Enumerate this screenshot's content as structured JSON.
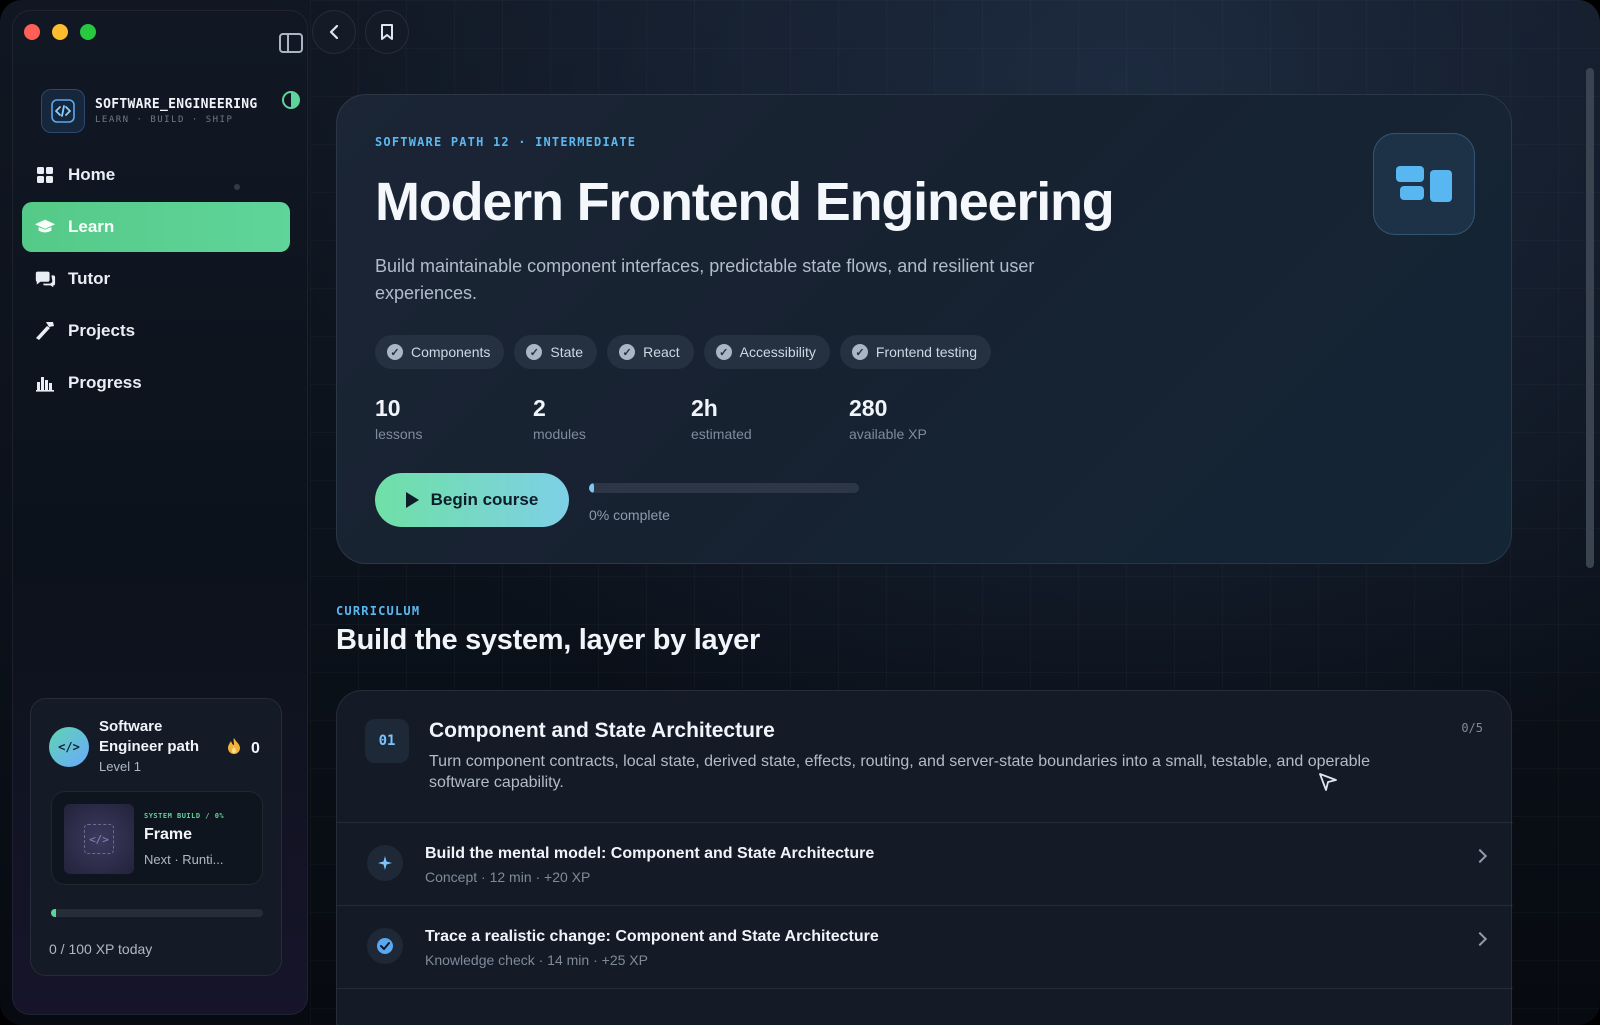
{
  "sidebar": {
    "brand_title": "SOFTWARE_ENGINEERING",
    "brand_sub": "LEARN · BUILD · SHIP",
    "nav": [
      {
        "label": "Home",
        "icon": "grid-icon",
        "active": false
      },
      {
        "label": "Learn",
        "icon": "graduation-cap-icon",
        "active": true
      },
      {
        "label": "Tutor",
        "icon": "chat-bubbles-icon",
        "active": false
      },
      {
        "label": "Projects",
        "icon": "hammer-icon",
        "active": false
      },
      {
        "label": "Progress",
        "icon": "bar-chart-icon",
        "active": false
      }
    ],
    "profile": {
      "avatar_text": "</>",
      "path_title": "Software Engineer path",
      "level": "Level 1",
      "streak": "0",
      "build_kicker": "SYSTEM BUILD / 0%",
      "build_title": "Frame",
      "build_next": "Next · Runti...",
      "xp_progress": 0,
      "xp_text": "0 / 100 XP today"
    }
  },
  "hero": {
    "kicker": "SOFTWARE PATH 12 · INTERMEDIATE",
    "title": "Modern Frontend Engineering",
    "description": "Build maintainable component interfaces, predictable state flows, and resilient user experiences.",
    "tags": [
      "Components",
      "State",
      "React",
      "Accessibility",
      "Frontend testing"
    ],
    "stats": [
      {
        "value": "10",
        "label": "lessons"
      },
      {
        "value": "2",
        "label": "modules"
      },
      {
        "value": "2h",
        "label": "estimated"
      },
      {
        "value": "280",
        "label": "available XP"
      }
    ],
    "cta": "Begin course",
    "progress": 0,
    "progress_text": "0% complete"
  },
  "curriculum": {
    "kicker": "CURRICULUM",
    "title": "Build the system, layer by layer",
    "module": {
      "number": "01",
      "title": "Component and State Architecture",
      "description": "Turn component contracts, local state, derived state, effects, routing, and server-state boundaries into a small, testable, and operable software capability.",
      "count": "0/5",
      "lessons": [
        {
          "title": "Build the mental model: Component and State Architecture",
          "meta": "Concept · 12 min · +20 XP",
          "icon": "sparkle-icon"
        },
        {
          "title": "Trace a realistic change: Component and State Architecture",
          "meta": "Knowledge check · 14 min · +25 XP",
          "icon": "check-badge-icon"
        }
      ]
    }
  },
  "colors": {
    "accent_green": "#5fd49a",
    "accent_blue": "#5ab8f0"
  }
}
